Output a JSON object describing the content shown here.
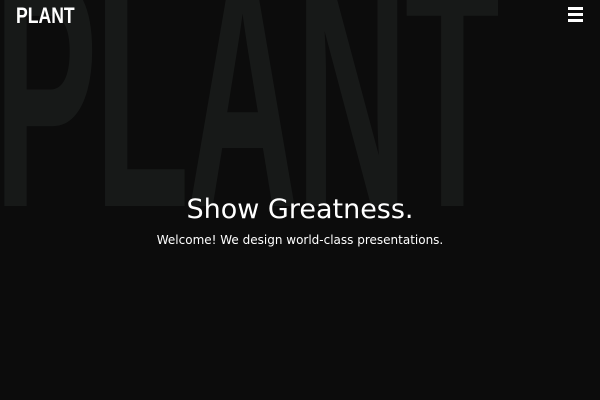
{
  "header": {
    "logo_text": "PLANT",
    "menu_icon": "hamburger-menu-icon"
  },
  "backdrop": {
    "word": "PLANT"
  },
  "hero": {
    "headline": "Show Greatness.",
    "subheadline": "Welcome! We design world-class presentations."
  },
  "colors": {
    "background": "#0c0c0c",
    "backdrop_text": "#171918",
    "foreground": "#ffffff"
  }
}
